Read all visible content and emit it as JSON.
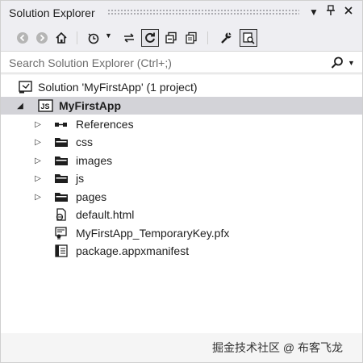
{
  "window": {
    "title": "Solution Explorer",
    "controls": {
      "dropdown_icon": "dropdown-arrow-icon",
      "pin_icon": "pin-icon",
      "close_icon": "close-icon"
    }
  },
  "toolbar": {
    "buttons": [
      {
        "name": "back",
        "icon": "back-arrow-icon",
        "state": "disabled"
      },
      {
        "name": "forward",
        "icon": "forward-arrow-icon",
        "state": "disabled"
      },
      {
        "name": "home",
        "icon": "home-icon",
        "state": "normal"
      },
      {
        "name": "pending-changes-filter",
        "icon": "clock-filter-icon",
        "state": "normal"
      },
      {
        "name": "sync-with-active-document",
        "icon": "sync-icon",
        "state": "normal"
      },
      {
        "name": "refresh",
        "icon": "refresh-icon",
        "state": "active"
      },
      {
        "name": "collapse-all",
        "icon": "collapse-all-icon",
        "state": "normal"
      },
      {
        "name": "show-all-files",
        "icon": "show-all-files-icon",
        "state": "normal"
      },
      {
        "name": "properties",
        "icon": "wrench-icon",
        "state": "normal"
      },
      {
        "name": "preview-selected-items",
        "icon": "preview-icon",
        "state": "active"
      }
    ]
  },
  "search": {
    "placeholder": "Search Solution Explorer (Ctrl+;)",
    "icon": "search-icon"
  },
  "tree": {
    "items": [
      {
        "label": "Solution 'MyFirstApp' (1 project)",
        "icon": "solution-icon",
        "level": 0,
        "expander": "none",
        "selected": false,
        "bold": false
      },
      {
        "label": "MyFirstApp",
        "icon": "js-project-icon",
        "level": 0,
        "expander": "expanded",
        "selected": true,
        "bold": true
      },
      {
        "label": "References",
        "icon": "references-icon",
        "level": 1,
        "expander": "collapsed",
        "selected": false,
        "bold": false
      },
      {
        "label": "css",
        "icon": "folder-icon",
        "level": 1,
        "expander": "collapsed",
        "selected": false,
        "bold": false
      },
      {
        "label": "images",
        "icon": "folder-icon",
        "level": 1,
        "expander": "collapsed",
        "selected": false,
        "bold": false
      },
      {
        "label": "js",
        "icon": "folder-icon",
        "level": 1,
        "expander": "collapsed",
        "selected": false,
        "bold": false
      },
      {
        "label": "pages",
        "icon": "folder-icon",
        "level": 1,
        "expander": "collapsed",
        "selected": false,
        "bold": false
      },
      {
        "label": "default.html",
        "icon": "html-file-icon",
        "level": 1,
        "expander": "none",
        "selected": false,
        "bold": false
      },
      {
        "label": "MyFirstApp_TemporaryKey.pfx",
        "icon": "certificate-file-icon",
        "level": 1,
        "expander": "none",
        "selected": false,
        "bold": false
      },
      {
        "label": "package.appxmanifest",
        "icon": "manifest-file-icon",
        "level": 1,
        "expander": "none",
        "selected": false,
        "bold": false
      }
    ]
  },
  "watermark": {
    "text": "掘金技术社区 @ 布客飞龙"
  },
  "colors": {
    "selection": "#d3d3d8",
    "chrome": "#eeeef2",
    "text": "#1e1e1e"
  }
}
